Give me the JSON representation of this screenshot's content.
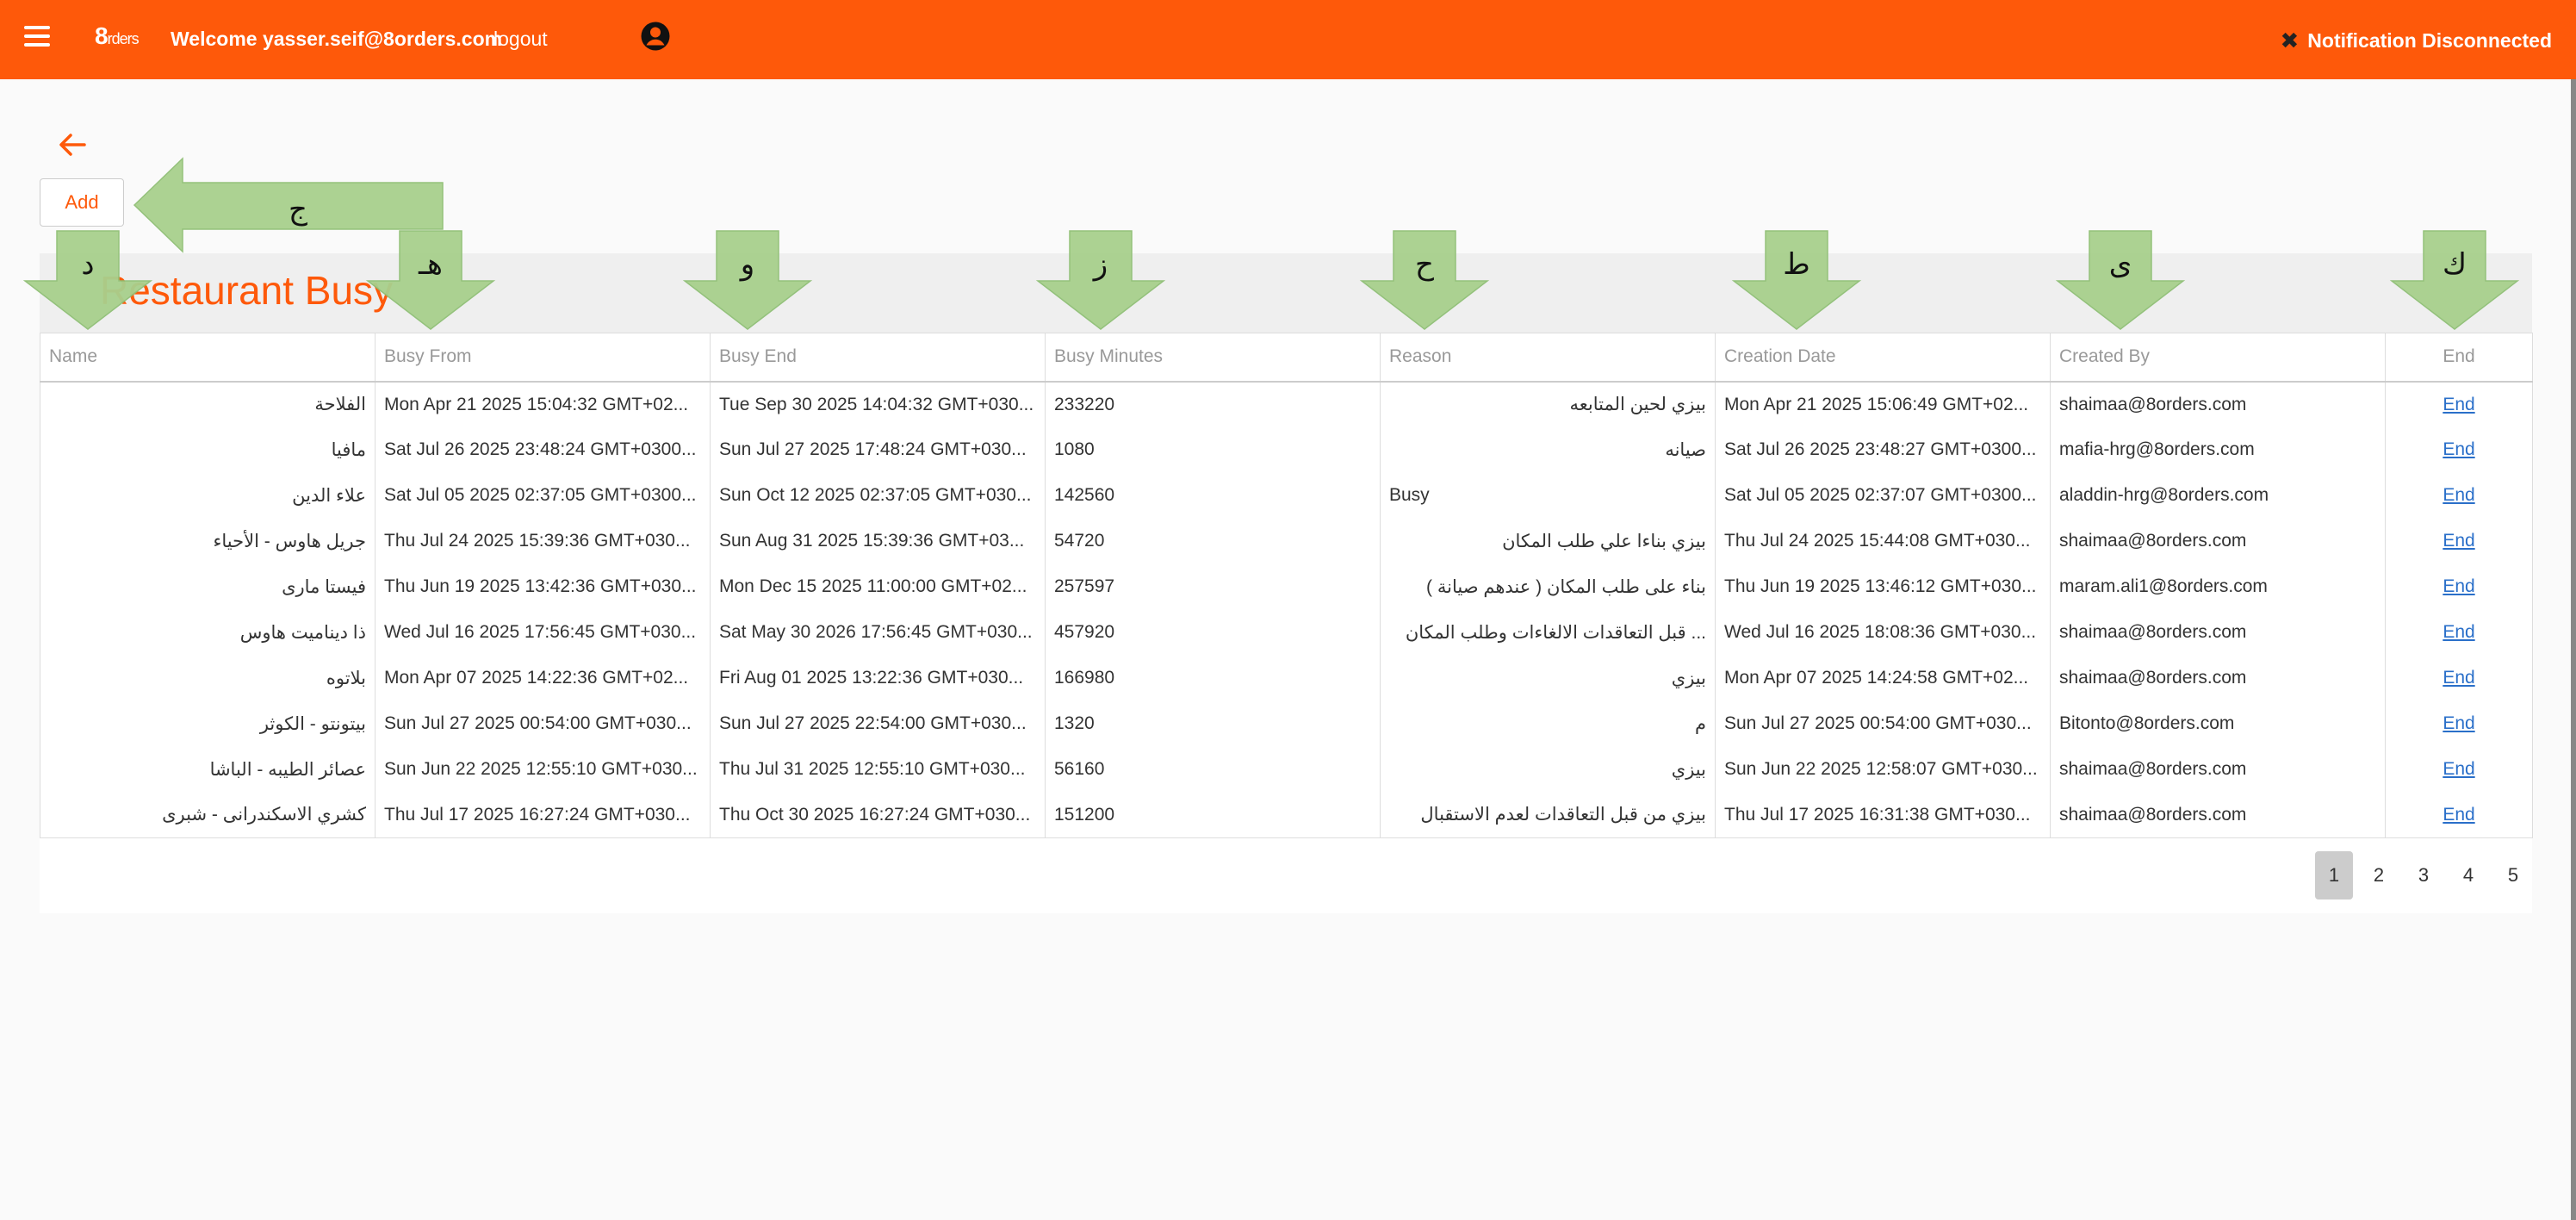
{
  "header": {
    "logo_main": "8",
    "logo_sub": "rders",
    "welcome": "Welcome yasser.seif@8orders.com",
    "logout_label": "logout",
    "notification": "Notification Disconnected",
    "bar_color": "#fe590a"
  },
  "toolbar": {
    "add_label": "Add"
  },
  "page": {
    "title": "Restaurant Busy"
  },
  "table": {
    "columns": [
      "Name",
      "Busy From",
      "Busy End",
      "Busy Minutes",
      "Reason",
      "Creation Date",
      "Created By",
      "End"
    ],
    "rows": [
      [
        "الفلاحة",
        "Mon Apr 21 2025 15:04:32 GMT+02...",
        "Tue Sep 30 2025 14:04:32 GMT+030...",
        "233220",
        "بيزي لحين المتابعه",
        "Mon Apr 21 2025 15:06:49 GMT+02...",
        "shaimaa@8orders.com",
        "End"
      ],
      [
        "مافيا",
        "Sat Jul 26 2025 23:48:24 GMT+0300...",
        "Sun Jul 27 2025 17:48:24 GMT+030...",
        "1080",
        "صيانه",
        "Sat Jul 26 2025 23:48:27 GMT+0300...",
        "mafia-hrg@8orders.com",
        "End"
      ],
      [
        "علاء الدين",
        "Sat Jul 05 2025 02:37:05 GMT+0300...",
        "Sun Oct 12 2025 02:37:05 GMT+030...",
        "142560",
        "Busy",
        "Sat Jul 05 2025 02:37:07 GMT+0300...",
        "aladdin-hrg@8orders.com",
        "End"
      ],
      [
        "جريل هاوس - الأحياء",
        "Thu Jul 24 2025 15:39:36 GMT+030...",
        "Sun Aug 31 2025 15:39:36 GMT+03...",
        "54720",
        "بيزي بناءا علي طلب المكان",
        "Thu Jul 24 2025 15:44:08 GMT+030...",
        "shaimaa@8orders.com",
        "End"
      ],
      [
        "فيستا مارى",
        "Thu Jun 19 2025 13:42:36 GMT+030...",
        "Mon Dec 15 2025 11:00:00 GMT+02...",
        "257597",
        "بناء على طلب المكان ( عندهم صيانة )",
        "Thu Jun 19 2025 13:46:12 GMT+030...",
        "maram.ali1@8orders.com",
        "End"
      ],
      [
        "ذا ديناميت هاوس",
        "Wed Jul 16 2025 17:56:45 GMT+030...",
        "Sat May 30 2026 17:56:45 GMT+030...",
        "457920",
        "... قبل التعاقدات الالغاءات وطلب المكان",
        "Wed Jul 16 2025 18:08:36 GMT+030...",
        "shaimaa@8orders.com",
        "End"
      ],
      [
        "بلاتوه",
        "Mon Apr 07 2025 14:22:36 GMT+02...",
        "Fri Aug 01 2025 13:22:36 GMT+030...",
        "166980",
        "بيزي",
        "Mon Apr 07 2025 14:24:58 GMT+02...",
        "shaimaa@8orders.com",
        "End"
      ],
      [
        "بيتونتو - الكوثر",
        "Sun Jul 27 2025 00:54:00 GMT+030...",
        "Sun Jul 27 2025 22:54:00 GMT+030...",
        "1320",
        "م",
        "Sun Jul 27 2025 00:54:00 GMT+030...",
        "Bitonto@8orders.com",
        "End"
      ],
      [
        "عصائر الطيبه - الباشا",
        "Sun Jun 22 2025 12:55:10 GMT+030...",
        "Thu Jul 31 2025 12:55:10 GMT+030...",
        "56160",
        "بيزي",
        "Sun Jun 22 2025 12:58:07 GMT+030...",
        "shaimaa@8orders.com",
        "End"
      ],
      [
        "كشري الاسكندرانى - شبرى",
        "Thu Jul 17 2025 16:27:24 GMT+030...",
        "Thu Oct 30 2025 16:27:24 GMT+030...",
        "151200",
        "بيزي من قبل التعاقدات لعدم الاستقبال",
        "Thu Jul 17 2025 16:31:38 GMT+030...",
        "shaimaa@8orders.com",
        "End"
      ]
    ]
  },
  "pagination": {
    "pages": [
      "1",
      "2",
      "3",
      "4",
      "5"
    ],
    "active": "1"
  },
  "annotations": {
    "add_label": "ج",
    "column_labels": [
      "د",
      "هـ",
      "و",
      "ز",
      "ح",
      "ط",
      "ى",
      "ك"
    ],
    "color": "#a8d08d"
  }
}
